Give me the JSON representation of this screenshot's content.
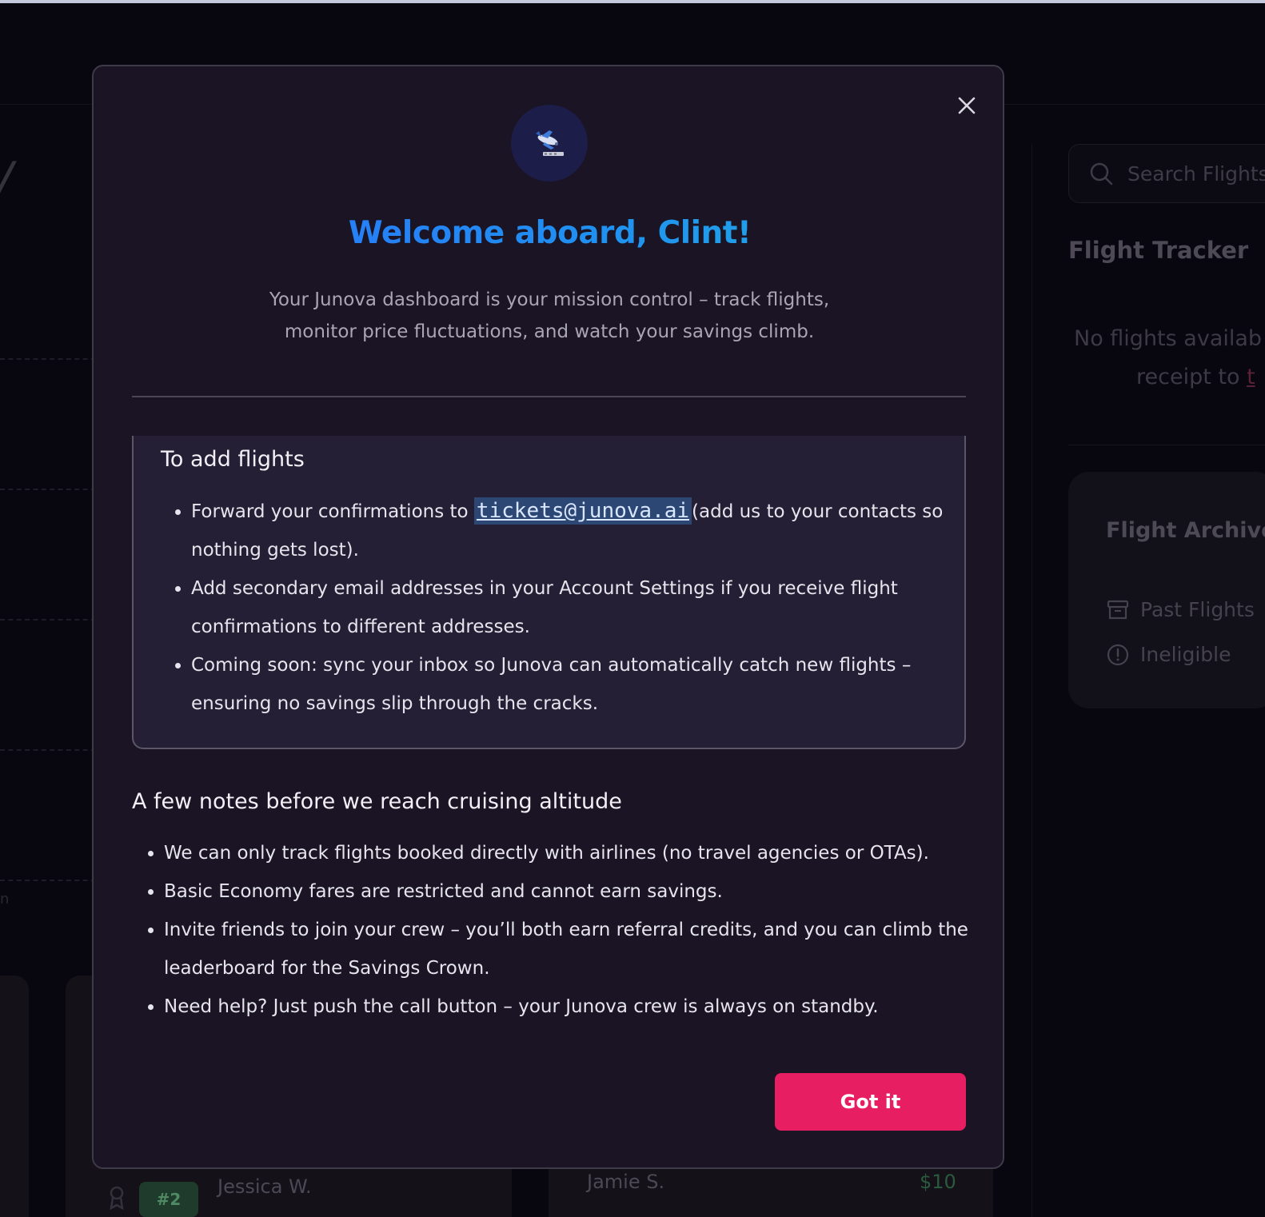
{
  "background": {
    "search": {
      "placeholder": "Search Flights"
    },
    "flight_tracker": {
      "title": "Flight Tracker",
      "empty_line_1": "No flights availab",
      "empty_line_2_prefix": "receipt to ",
      "empty_line_2_link": "t"
    },
    "flight_archive": {
      "title": "Flight Archive",
      "items": [
        {
          "label": "Past Flights",
          "icon": "archive-box-icon"
        },
        {
          "label": "Ineligible",
          "icon": "alert-circle-icon"
        }
      ]
    },
    "leaderboard": {
      "rank": "#2",
      "name": "Jessica W.",
      "name_2": "Jamie S.",
      "amount_2": "$10"
    }
  },
  "modal": {
    "heading": "Welcome aboard, Clint!",
    "subtitle_line_1": "Your Junova dashboard is your mission control – track flights,",
    "subtitle_line_2": "monitor price fluctuations, and watch your savings climb.",
    "add_flights": {
      "title": "To add flights",
      "item_1_prefix": "Forward your confirmations to ",
      "item_1_email": "tickets@junova.ai",
      "item_1_suffix": "(add us to your contacts so nothing gets lost).",
      "item_2": "Add secondary email addresses in your Account Settings if you receive flight confirmations to different addresses.",
      "item_3": "Coming soon: sync your inbox so Junova can automatically catch new flights – ensuring no savings slip through the cracks."
    },
    "notes": {
      "title": "A few notes before we reach cruising altitude",
      "items": [
        "We can only track flights booked directly with airlines (no travel agencies or OTAs).",
        "Basic Economy fares are restricted and cannot earn savings.",
        "Invite friends to join your crew – you’ll both earn referral credits, and you can climb the leaderboard for the Savings Crown.",
        "Need help? Just push the call button – your Junova crew is always on standby."
      ]
    },
    "confirm_label": "Got it",
    "colors": {
      "accent_button": "#e81e63",
      "heading_gradient_start": "#2c6fff",
      "heading_gradient_end": "#23b4e0",
      "email_highlight": "#2d4774"
    }
  }
}
